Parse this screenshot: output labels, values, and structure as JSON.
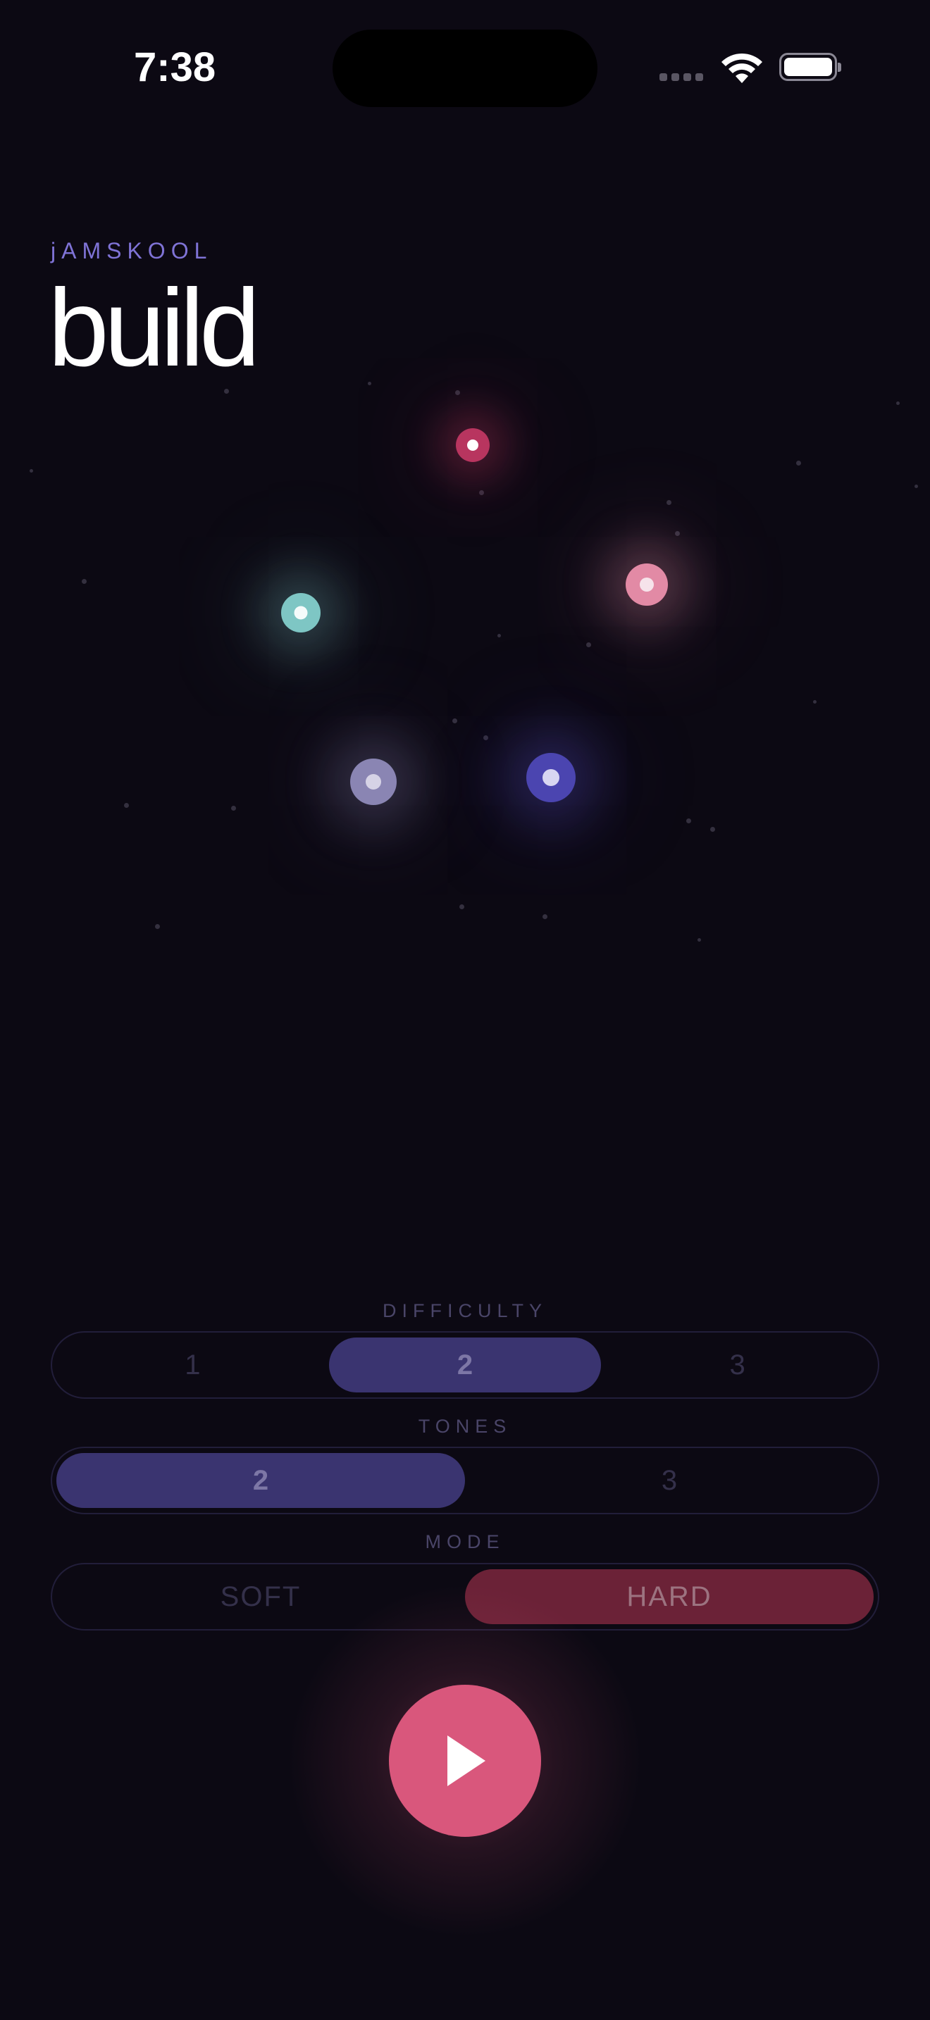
{
  "status_bar": {
    "time": "7:38"
  },
  "header": {
    "brand": "jAMSKOOL",
    "title": "build"
  },
  "stage": {
    "orbs": [
      {
        "name": "orb-red",
        "color": "#b8355f"
      },
      {
        "name": "orb-pink",
        "color": "#e28aa5"
      },
      {
        "name": "orb-teal",
        "color": "#7ec6c4"
      },
      {
        "name": "orb-lavender",
        "color": "#8a85b3"
      },
      {
        "name": "orb-indigo",
        "color": "#4b45b0"
      }
    ]
  },
  "controls": {
    "difficulty": {
      "label": "DIFFICULTY",
      "options": [
        "1",
        "2",
        "3"
      ],
      "selected": "2"
    },
    "tones": {
      "label": "TONES",
      "options": [
        "2",
        "3"
      ],
      "selected": "2"
    },
    "mode": {
      "label": "MODE",
      "options": [
        "SOFT",
        "HARD"
      ],
      "selected": "HARD"
    }
  },
  "play": {
    "icon": "play-icon",
    "color": "#d9577c"
  },
  "colors": {
    "background": "#0c0913",
    "accent": "#7f73d6",
    "selected_segment": "#3a3470",
    "hard_segment": "#6b2237"
  }
}
